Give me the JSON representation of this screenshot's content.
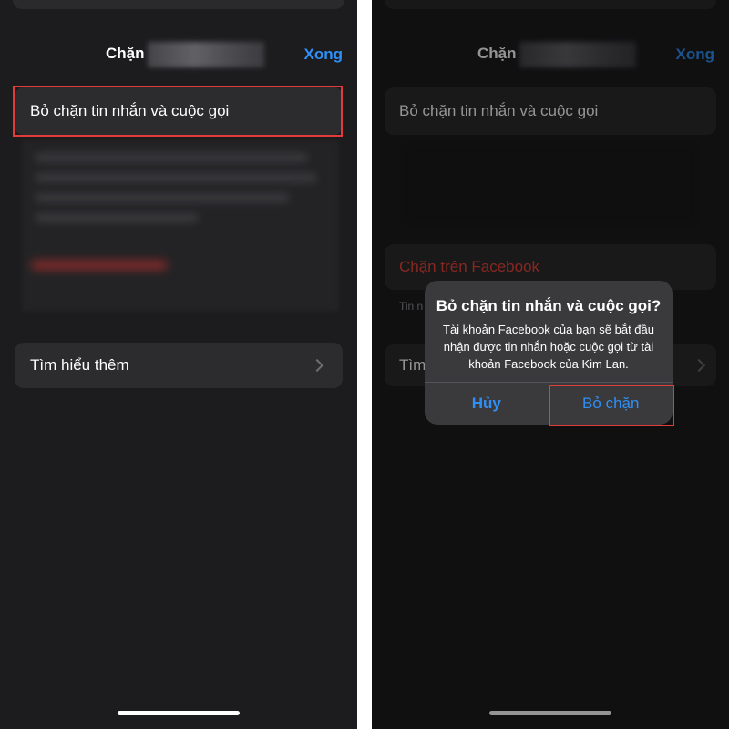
{
  "left_screen": {
    "nav": {
      "title": "Chặn",
      "done": "Xong"
    },
    "unblock_row": "Bỏ chặn tin nhắn và cuộc gọi",
    "learn_more": "Tìm hiểu thêm"
  },
  "right_screen": {
    "nav": {
      "title": "Chặn",
      "done": "Xong"
    },
    "unblock_row": "Bỏ chặn tin nhắn và cuộc gọi",
    "block_facebook": "Chặn trên Facebook",
    "caption_fragment": "Tin n",
    "learn_more_fragment": "Tìm",
    "alert": {
      "title": "Bỏ chặn tin nhắn và cuộc gọi?",
      "message": "Tài khoản Facebook của bạn sẽ bắt đầu nhận được tin nhắn hoặc cuộc gọi từ tài khoản Facebook của Kim Lan.",
      "cancel": "Hủy",
      "confirm": "Bỏ chặn"
    }
  },
  "colors": {
    "background": "#1c1c1e",
    "cell": "#2c2c2e",
    "accent_blue": "#2f8ff5",
    "destructive_red": "#e5453c",
    "highlight": "#e23b3b"
  },
  "icons": [
    "chevron-right-icon"
  ]
}
